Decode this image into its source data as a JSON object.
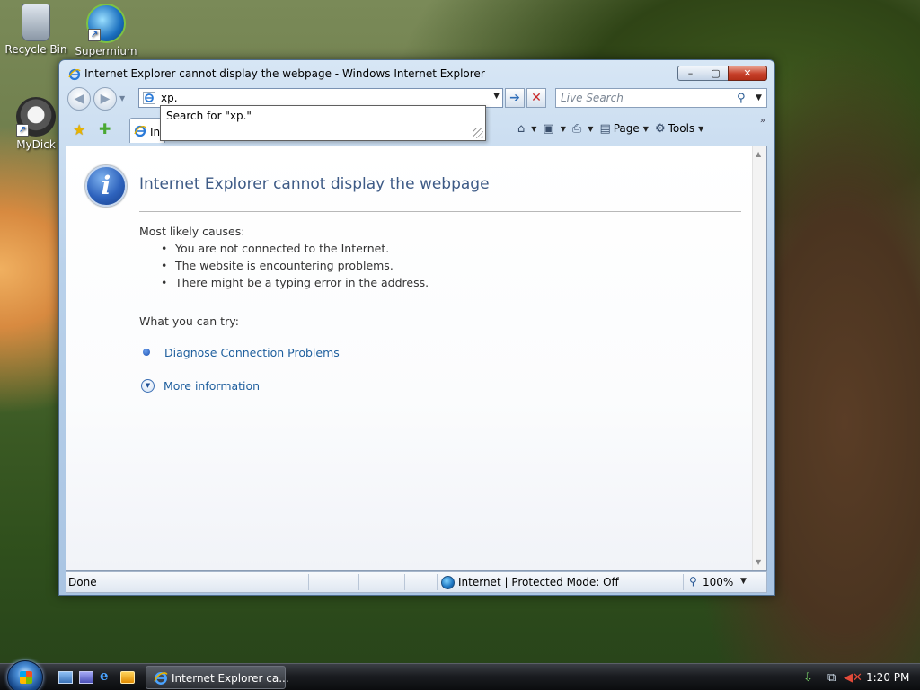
{
  "desktop": {
    "icons": [
      {
        "label": "Recycle Bin"
      },
      {
        "label": "Supermium"
      },
      {
        "label": "MyDick"
      }
    ]
  },
  "window": {
    "title": "Internet Explorer cannot display the webpage - Windows Internet Explorer",
    "caption": {
      "minimize": "–",
      "maximize": "▢",
      "close": "✕"
    }
  },
  "navbar": {
    "back": "◀",
    "forward": "▶",
    "address_value": "xp.",
    "go": "➔",
    "stop": "✕",
    "search_placeholder": "Live Search"
  },
  "autocomplete": {
    "item": "Search for \"xp.\""
  },
  "commandbar": {
    "tab_label": "Int",
    "items": [
      {
        "label": "",
        "icon": "home-icon"
      },
      {
        "label": "",
        "icon": "feeds-icon"
      },
      {
        "label": "",
        "icon": "print-icon"
      },
      {
        "label": "Page",
        "icon": "page-icon"
      },
      {
        "label": "Tools",
        "icon": "tools-icon"
      }
    ]
  },
  "page": {
    "heading": "Internet Explorer cannot display the webpage",
    "causes_heading": "Most likely causes:",
    "causes": [
      "You are not connected to the Internet.",
      "The website is encountering problems.",
      "There might be a typing error in the address."
    ],
    "try_heading": "What you can try:",
    "diagnose_link": "Diagnose Connection Problems",
    "more_info_link": "More information"
  },
  "statusbar": {
    "status": "Done",
    "zone": "Internet | Protected Mode: Off",
    "zoom": "100%"
  },
  "taskbar": {
    "task_label": "Internet Explorer ca...",
    "clock": "1:20 PM"
  }
}
